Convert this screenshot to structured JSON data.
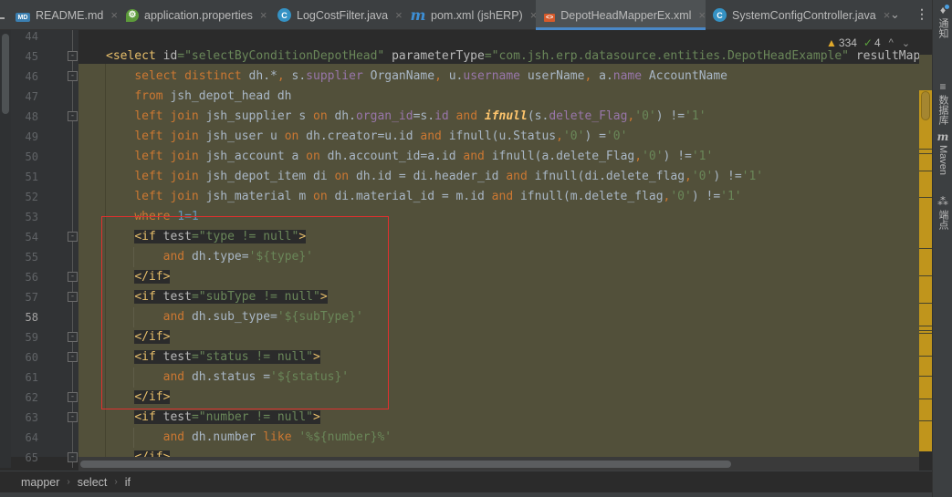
{
  "tabs": [
    {
      "label": "README.md",
      "icon": "markdown-file-icon",
      "icon_text": "MD",
      "active": false
    },
    {
      "label": "application.properties",
      "icon": "spring-properties-icon",
      "icon_text": "⚙",
      "active": false
    },
    {
      "label": "LogCostFilter.java",
      "icon": "java-class-icon",
      "icon_text": "C",
      "active": false
    },
    {
      "label": "pom.xml (jshERP)",
      "icon": "maven-icon",
      "icon_text": "m",
      "active": false
    },
    {
      "label": "DepotHeadMapperEx.xml",
      "icon": "xml-file-icon",
      "icon_text": "<>",
      "active": true
    },
    {
      "label": "SystemConfigController.java",
      "icon": "java-class-icon",
      "icon_text": "C",
      "active": false
    }
  ],
  "tab_close_glyph": "×",
  "tab_overflow_glyph": "⌄",
  "tab_menu_glyph": "⋮",
  "right_toolbar": [
    {
      "label": "通知",
      "icon": "bell-icon",
      "glyph": "🔔"
    },
    {
      "label": "数据库",
      "icon": "database-icon",
      "glyph": "≡"
    },
    {
      "label": "Maven",
      "icon": "maven-icon",
      "glyph": "m"
    },
    {
      "label": "端点",
      "icon": "endpoints-icon",
      "glyph": "⁂"
    }
  ],
  "inspection": {
    "warning_glyph": "▲",
    "warnings": "334",
    "ok_glyph": "✓",
    "weak_warnings": "4",
    "prev_glyph": "^",
    "next_glyph": "⌄"
  },
  "editor": {
    "current_line": 58,
    "line_numbers": [
      "44",
      "45",
      "46",
      "47",
      "48",
      "49",
      "50",
      "51",
      "52",
      "53",
      "54",
      "55",
      "56",
      "57",
      "58",
      "59",
      "60",
      "61",
      "62",
      "63",
      "64",
      "65"
    ],
    "lines": [
      [],
      [
        [
          "t",
          "<select "
        ],
        [
          "a",
          "id"
        ],
        [
          "s",
          "=\"selectByConditionDepotHead\" "
        ],
        [
          "a",
          "parameterType"
        ],
        [
          "s",
          "=\"com.jsh.erp.datasource.entities.DepotHeadExample\" "
        ],
        [
          "a",
          "resultMap"
        ],
        [
          "s",
          "=\""
        ]
      ],
      [
        [
          "x",
          "    "
        ],
        [
          "k",
          "select distinct "
        ],
        [
          "x",
          "dh.*"
        ],
        [
          "k",
          ", "
        ],
        [
          "x",
          "s."
        ],
        [
          "p",
          "supplier"
        ],
        [
          "x",
          " OrganName"
        ],
        [
          "k",
          ", "
        ],
        [
          "x",
          "u."
        ],
        [
          "p",
          "username"
        ],
        [
          "x",
          " userName"
        ],
        [
          "k",
          ", "
        ],
        [
          "x",
          "a."
        ],
        [
          "p",
          "name"
        ],
        [
          "x",
          " AccountName"
        ]
      ],
      [
        [
          "x",
          "    "
        ],
        [
          "k",
          "from "
        ],
        [
          "x",
          "jsh_depot_head dh"
        ]
      ],
      [
        [
          "x",
          "    "
        ],
        [
          "k",
          "left join "
        ],
        [
          "x",
          "jsh_supplier s "
        ],
        [
          "k",
          "on "
        ],
        [
          "x",
          "dh."
        ],
        [
          "p",
          "organ_id"
        ],
        [
          "x",
          "=s."
        ],
        [
          "p",
          "id"
        ],
        [
          "k",
          " and "
        ],
        [
          "i",
          "ifnull"
        ],
        [
          "x",
          "(s."
        ],
        [
          "p",
          "delete_Flag"
        ],
        [
          "k",
          ","
        ],
        [
          "s",
          "'0'"
        ],
        [
          "x",
          ") !="
        ],
        [
          "s",
          "'1'"
        ]
      ],
      [
        [
          "x",
          "    "
        ],
        [
          "k",
          "left join "
        ],
        [
          "x",
          "jsh_user u "
        ],
        [
          "k",
          "on "
        ],
        [
          "x",
          "dh.creator=u.id "
        ],
        [
          "k",
          "and "
        ],
        [
          "x",
          "ifnull(u.Status"
        ],
        [
          "k",
          ","
        ],
        [
          "s",
          "'0'"
        ],
        [
          "x",
          ") ="
        ],
        [
          "s",
          "'0'"
        ]
      ],
      [
        [
          "x",
          "    "
        ],
        [
          "k",
          "left join "
        ],
        [
          "x",
          "jsh_account a "
        ],
        [
          "k",
          "on "
        ],
        [
          "x",
          "dh.account_id=a.id "
        ],
        [
          "k",
          "and "
        ],
        [
          "x",
          "ifnull(a.delete_Flag"
        ],
        [
          "k",
          ","
        ],
        [
          "s",
          "'0'"
        ],
        [
          "x",
          ") !="
        ],
        [
          "s",
          "'1'"
        ]
      ],
      [
        [
          "x",
          "    "
        ],
        [
          "k",
          "left join "
        ],
        [
          "x",
          "jsh_depot_item di "
        ],
        [
          "k",
          "on "
        ],
        [
          "x",
          "dh.id = di.header_id "
        ],
        [
          "k",
          "and "
        ],
        [
          "x",
          "ifnull(di.delete_flag"
        ],
        [
          "k",
          ","
        ],
        [
          "s",
          "'0'"
        ],
        [
          "x",
          ") !="
        ],
        [
          "s",
          "'1'"
        ]
      ],
      [
        [
          "x",
          "    "
        ],
        [
          "k",
          "left join "
        ],
        [
          "x",
          "jsh_material m "
        ],
        [
          "k",
          "on "
        ],
        [
          "x",
          "di.material_id = m.id "
        ],
        [
          "k",
          "and "
        ],
        [
          "x",
          "ifnull(m.delete_flag"
        ],
        [
          "k",
          ","
        ],
        [
          "s",
          "'0'"
        ],
        [
          "x",
          ") !="
        ],
        [
          "s",
          "'1'"
        ]
      ],
      [
        [
          "x",
          "    "
        ],
        [
          "k",
          "where "
        ],
        [
          "n",
          "1=1"
        ]
      ],
      [
        [
          "x",
          "    "
        ],
        [
          "T",
          "<if "
        ],
        [
          "A",
          "test"
        ],
        [
          "S",
          "=\"type != null\""
        ],
        [
          "T",
          ">"
        ]
      ],
      [
        [
          "x",
          "        "
        ],
        [
          "k",
          "and "
        ],
        [
          "x",
          "dh.type="
        ],
        [
          "s",
          "'${type}'"
        ]
      ],
      [
        [
          "x",
          "    "
        ],
        [
          "T",
          "</if>"
        ]
      ],
      [
        [
          "x",
          "    "
        ],
        [
          "T",
          "<if "
        ],
        [
          "A",
          "test"
        ],
        [
          "S",
          "=\"subType != null\""
        ],
        [
          "T",
          ">"
        ]
      ],
      [
        [
          "x",
          "        "
        ],
        [
          "k",
          "and "
        ],
        [
          "x",
          "dh.sub_type="
        ],
        [
          "s",
          "'${subType}'"
        ]
      ],
      [
        [
          "x",
          "    "
        ],
        [
          "T",
          "</if>"
        ]
      ],
      [
        [
          "x",
          "    "
        ],
        [
          "T",
          "<if "
        ],
        [
          "A",
          "test"
        ],
        [
          "S",
          "=\"status != null\""
        ],
        [
          "T",
          ">"
        ]
      ],
      [
        [
          "x",
          "        "
        ],
        [
          "k",
          "and "
        ],
        [
          "x",
          "dh.status ="
        ],
        [
          "s",
          "'${status}'"
        ]
      ],
      [
        [
          "x",
          "    "
        ],
        [
          "T",
          "</if>"
        ]
      ],
      [
        [
          "x",
          "    "
        ],
        [
          "T",
          "<if "
        ],
        [
          "A",
          "test"
        ],
        [
          "S",
          "=\"number != null\""
        ],
        [
          "T",
          ">"
        ]
      ],
      [
        [
          "x",
          "        "
        ],
        [
          "k",
          "and "
        ],
        [
          "x",
          "dh.number "
        ],
        [
          "k",
          "like "
        ],
        [
          "s",
          "'%${number}%'"
        ]
      ],
      [
        [
          "x",
          "    "
        ],
        [
          "T",
          "</if>"
        ]
      ]
    ]
  },
  "breadcrumb": [
    "mapper",
    "select",
    "if"
  ],
  "breadcrumb_sep": "›"
}
